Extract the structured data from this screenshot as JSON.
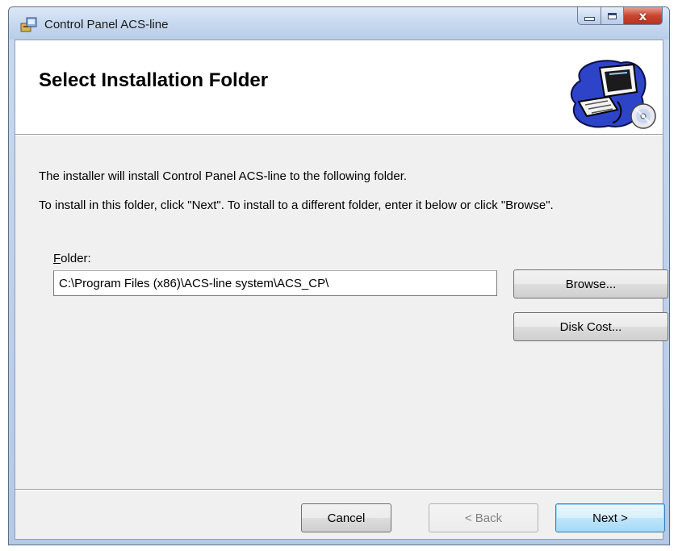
{
  "window": {
    "title": "Control Panel ACS-line",
    "controls": {
      "minimize": "minimize",
      "maximize": "maximize",
      "close": "x"
    }
  },
  "banner": {
    "title": "Select Installation Folder",
    "icon": "computer-with-disc-icon"
  },
  "body": {
    "line1": "The installer will install Control Panel ACS-line to the following folder.",
    "line2": "To install in this folder, click \"Next\". To install to a different folder, enter it below or click \"Browse\"."
  },
  "folder": {
    "label_accel": "F",
    "label_rest": "older:",
    "value": "C:\\Program Files (x86)\\ACS-line system\\ACS_CP\\"
  },
  "buttons": {
    "browse": "Browse...",
    "disk_cost": "Disk Cost...",
    "cancel": "Cancel",
    "back": "< Back",
    "next": "Next >"
  },
  "colors": {
    "title_bar": "#c7d9ef",
    "close_button": "#c9452f",
    "dialog_background": "#f0f0f0",
    "default_button": "#bee6fd"
  }
}
